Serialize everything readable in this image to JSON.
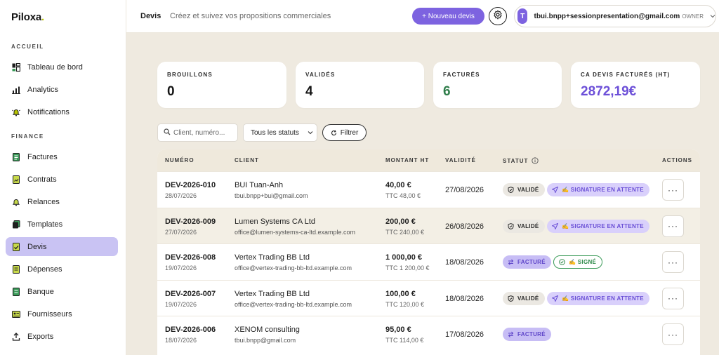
{
  "app": {
    "logo": "Piloxa",
    "logo_dot": "."
  },
  "sidebar": {
    "sections": [
      {
        "label": "ACCUEIL",
        "items": [
          {
            "label": "Tableau de bord",
            "icon": "dashboard-icon"
          },
          {
            "label": "Analytics",
            "icon": "bar-chart-icon"
          },
          {
            "label": "Notifications",
            "icon": "bell-icon"
          }
        ]
      },
      {
        "label": "FINANCE",
        "items": [
          {
            "label": "Factures",
            "icon": "invoice-icon"
          },
          {
            "label": "Contrats",
            "icon": "contract-icon"
          },
          {
            "label": "Relances",
            "icon": "bell-reminder-icon"
          },
          {
            "label": "Templates",
            "icon": "templates-icon"
          },
          {
            "label": "Devis",
            "icon": "quote-check-icon",
            "active": true
          },
          {
            "label": "Dépenses",
            "icon": "expenses-icon"
          },
          {
            "label": "Banque",
            "icon": "bank-icon"
          },
          {
            "label": "Fournisseurs",
            "icon": "suppliers-icon"
          },
          {
            "label": "Exports",
            "icon": "export-icon"
          }
        ]
      }
    ]
  },
  "topbar": {
    "title": "Devis",
    "subtitle": "Créez et suivez vos propositions commerciales",
    "new_button": "+ Nouveau devis",
    "user": {
      "initial": "T",
      "email": "tbui.bnpp+sessionpresentation@gmail.com",
      "role": "OWNER"
    }
  },
  "stats": [
    {
      "label": "BROUILLONS",
      "value": "0",
      "color": "#151515"
    },
    {
      "label": "VALIDÉS",
      "value": "4",
      "color": "#151515"
    },
    {
      "label": "FACTURÉS",
      "value": "6",
      "color": "#2f7d4a"
    },
    {
      "label": "CA DEVIS FACTURÉS (HT)",
      "value": "2872,19€",
      "color": "#6c4fd8"
    }
  ],
  "filters": {
    "search_placeholder": "Client, numéro...",
    "status_select": "Tous les statuts",
    "filter_button": "Filtrer"
  },
  "table": {
    "headers": {
      "number": "NUMÉRO",
      "client": "CLIENT",
      "amount": "MONTANT HT",
      "validity": "VALIDITÉ",
      "status": "STATUT",
      "actions": "ACTIONS"
    },
    "rows": [
      {
        "number": "DEV-2026-010",
        "date": "28/07/2026",
        "client": "BUI Tuan-Anh",
        "email": "tbui.bnpp+bui@gmail.com",
        "ht": "40,00 €",
        "ttc": "TTC 48,00 €",
        "validity": "27/08/2026",
        "badges": [
          {
            "type": "valid",
            "label": "VALIDÉ"
          },
          {
            "type": "wait",
            "label": "✍ SIGNATURE EN ATTENTE"
          }
        ]
      },
      {
        "number": "DEV-2026-009",
        "date": "27/07/2026",
        "client": "Lumen Systems CA Ltd",
        "email": "office@lumen-systems-ca-ltd.example.com",
        "ht": "200,00 €",
        "ttc": "TTC 240,00 €",
        "validity": "26/08/2026",
        "badges": [
          {
            "type": "valid",
            "label": "VALIDÉ"
          },
          {
            "type": "wait",
            "label": "✍ SIGNATURE EN ATTENTE"
          }
        ]
      },
      {
        "number": "DEV-2026-008",
        "date": "19/07/2026",
        "client": "Vertex Trading BB Ltd",
        "email": "office@vertex-trading-bb-ltd.example.com",
        "ht": "1 000,00 €",
        "ttc": "TTC 1 200,00 €",
        "validity": "18/08/2026",
        "badges": [
          {
            "type": "fact",
            "label": "FACTURÉ"
          },
          {
            "type": "signe",
            "label": "✍ SIGNÉ"
          }
        ]
      },
      {
        "number": "DEV-2026-007",
        "date": "19/07/2026",
        "client": "Vertex Trading BB Ltd",
        "email": "office@vertex-trading-bb-ltd.example.com",
        "ht": "100,00 €",
        "ttc": "TTC 120,00 €",
        "validity": "18/08/2026",
        "badges": [
          {
            "type": "valid",
            "label": "VALIDÉ"
          },
          {
            "type": "wait",
            "label": "✍ SIGNATURE EN ATTENTE"
          }
        ]
      },
      {
        "number": "DEV-2026-006",
        "date": "18/07/2026",
        "client": "XENOM consulting",
        "email": "tbui.bnpp@gmail.com",
        "ht": "95,00 €",
        "ttc": "TTC 114,00 €",
        "validity": "17/08/2026",
        "badges": [
          {
            "type": "fact",
            "label": "FACTURÉ"
          }
        ]
      }
    ],
    "action_label": "···"
  }
}
